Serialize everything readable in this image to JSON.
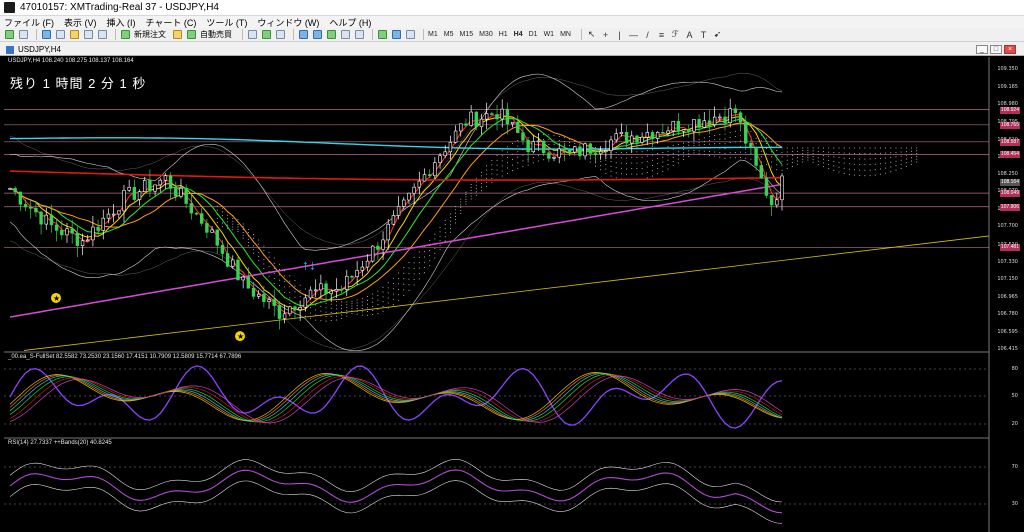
{
  "window": {
    "title": "47010157: XMTrading-Real 37 - USDJPY,H4"
  },
  "menu": {
    "items": [
      "ファイル (F)",
      "表示 (V)",
      "挿入 (I)",
      "チャート (C)",
      "ツール (T)",
      "ウィンドウ (W)",
      "ヘルプ (H)"
    ]
  },
  "toolbar": {
    "new_order": "新規注文",
    "auto_trade": "自動売買",
    "timeframes": [
      "M1",
      "M5",
      "M15",
      "M30",
      "H1",
      "H4",
      "D1",
      "W1",
      "MN"
    ],
    "active_timeframe": "H4"
  },
  "chart_window": {
    "title": "USDJPY,H4",
    "min": "_",
    "max": "□",
    "close": "×"
  },
  "chart_data": {
    "type": "candlestick",
    "symbol_header": "USDJPY,H4  108.240 108.275 108.137 108.164",
    "countdown": "残り 1 時間 2 分 1 秒",
    "price_axis": [
      "109.350",
      "109.165",
      "108.980",
      "108.795",
      "108.610",
      "108.425",
      "108.250",
      "108.070",
      "107.880",
      "107.700",
      "107.510",
      "107.330",
      "107.150",
      "106.965",
      "106.780",
      "106.595",
      "106.415"
    ],
    "price_tags": [
      {
        "value": "108.924",
        "color": "#b0305a"
      },
      {
        "value": "108.765",
        "color": "#b0305a"
      },
      {
        "value": "108.587",
        "color": "#b0305a"
      },
      {
        "value": "108.454",
        "color": "#b0305a"
      },
      {
        "value": "108.164",
        "color": "#555555"
      },
      {
        "value": "108.049",
        "color": "#b0305a"
      },
      {
        "value": "107.906",
        "color": "#b0305a"
      },
      {
        "value": "107.481",
        "color": "#b0305a"
      }
    ],
    "stoch_header": "_00.ea_S-FullSet 82.5582 73.2530 23.1560 17.4151 10.7909 12.5809 15.7714 67.7896",
    "stoch_axis": [
      "80",
      "50",
      "20"
    ],
    "rsi_header": "RSI(14) 27.7337   ++Bands(20) 40.8245",
    "rsi_axis": [
      "70",
      "30"
    ]
  },
  "colors": {
    "bull_candle": "#ffffff",
    "bear_candle": "#39d353",
    "bb": "#d0d0d0",
    "ma_red": "#ff2a2a",
    "ma_cyan": "#35d6e8",
    "ma_magenta": "#d64bd6",
    "ma_yellow": "#ffd400",
    "ma_green": "#2ee52e",
    "ma_orange": "#ff9d1a",
    "trend_line": "#d8c400",
    "level_line": "#e88aa8",
    "rsi": "#b04ad0",
    "stoch_main": "#8a44ff"
  }
}
